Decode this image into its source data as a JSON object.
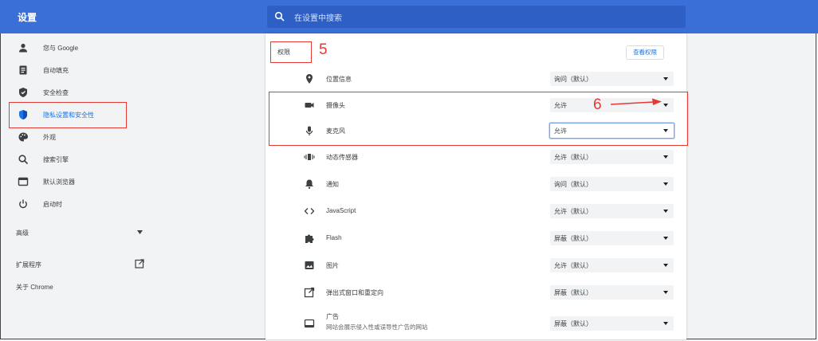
{
  "header": {
    "title": "设置",
    "search_placeholder": "在设置中搜索"
  },
  "sidebar": {
    "items": [
      {
        "label": "您与 Google",
        "icon": "person-icon"
      },
      {
        "label": "自动填充",
        "icon": "clipboard-icon"
      },
      {
        "label": "安全检查",
        "icon": "shield-icon"
      },
      {
        "label": "隐私设置和安全性",
        "icon": "shield-check-icon",
        "active": true
      },
      {
        "label": "外观",
        "icon": "palette-icon"
      },
      {
        "label": "搜索引擎",
        "icon": "search-icon"
      },
      {
        "label": "默认浏览器",
        "icon": "browser-icon"
      },
      {
        "label": "启动时",
        "icon": "power-icon"
      }
    ],
    "advanced": "高级",
    "extensions": "扩展程序",
    "about": "关于 Chrome"
  },
  "annotations": {
    "left_step": "5",
    "right_step": "6"
  },
  "main": {
    "section_title": "权限",
    "back_button": "查看权限",
    "rows": [
      {
        "label": "位置信息",
        "icon": "location-icon",
        "value": "询问（默认）"
      },
      {
        "label": "摄像头",
        "icon": "camera-icon",
        "value": "允许"
      },
      {
        "label": "麦克风",
        "icon": "microphone-icon",
        "value": "允许"
      },
      {
        "label": "动态传感器",
        "icon": "sensor-icon",
        "value": "允许（默认）"
      },
      {
        "label": "通知",
        "icon": "bell-icon",
        "value": "询问（默认）"
      },
      {
        "label": "JavaScript",
        "icon": "code-icon",
        "value": "允许（默认）"
      },
      {
        "label": "Flash",
        "icon": "puzzle-icon",
        "value": "屏蔽（默认）"
      },
      {
        "label": "图片",
        "icon": "image-icon",
        "value": "允许（默认）"
      },
      {
        "label": "弹出式窗口和重定向",
        "icon": "open-new-icon",
        "value": "屏蔽（默认）"
      },
      {
        "label": "广告",
        "sub": "网站会展示侵入性或误导性广告的网站",
        "icon": "ad-icon",
        "value": "屏蔽（默认）"
      }
    ]
  },
  "colors": {
    "header": "#3a6fd8",
    "accent": "#1a73e8",
    "annotation": "#e53935"
  }
}
